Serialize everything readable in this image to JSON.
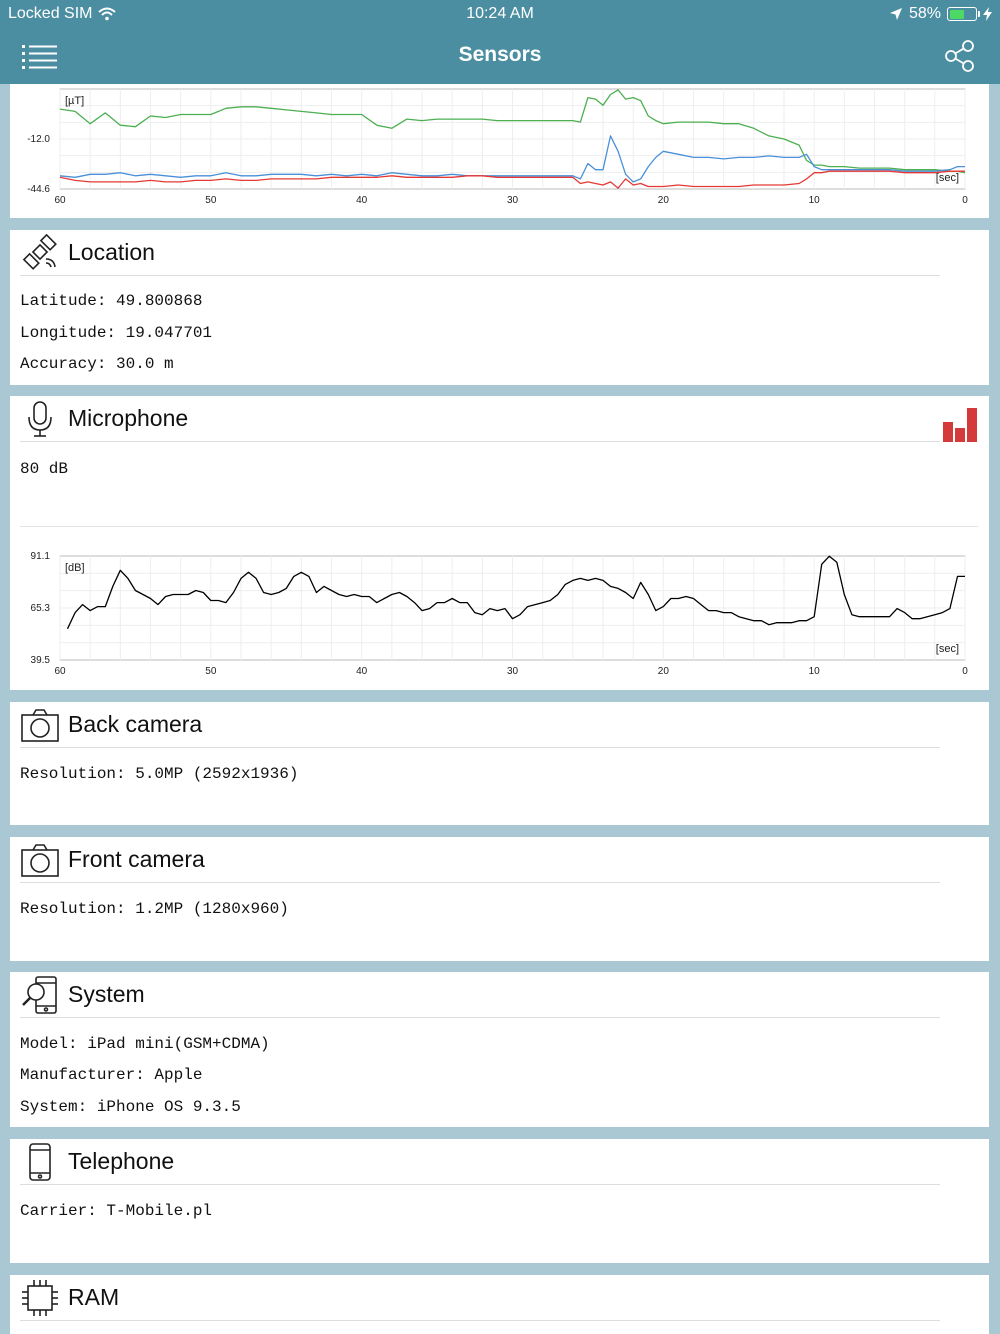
{
  "status_bar": {
    "carrier": "Locked SIM",
    "time": "10:24 AM",
    "battery_percent": "58%",
    "battery_level": 0.58
  },
  "nav": {
    "title": "Sensors",
    "menu_icon": "hamburger-icon",
    "share_icon": "share-icon"
  },
  "magnetometer": {
    "chart_data": {
      "type": "line",
      "ylabel": "[µT]",
      "xlabel": "[sec]",
      "y_ticks": [
        "-12.0",
        "-44.6"
      ],
      "x_ticks": [
        "60",
        "50",
        "40",
        "30",
        "20",
        "10",
        "0"
      ],
      "xlim": [
        60,
        0
      ],
      "ylim": [
        -44.6,
        20.6
      ],
      "series": [
        {
          "color": "#4caf50",
          "x": [
            60,
            59,
            58,
            57,
            56,
            55,
            54,
            53,
            52,
            51,
            50,
            49,
            48,
            47,
            46,
            45,
            44,
            43,
            42,
            41,
            40,
            39,
            38,
            37,
            36,
            35,
            34,
            33,
            32,
            31,
            30,
            29,
            28,
            27,
            26,
            25.5,
            25,
            24.5,
            24,
            23.5,
            23,
            22.5,
            22,
            21.5,
            21,
            20.5,
            20,
            19,
            18,
            17,
            16,
            15,
            14,
            13,
            12,
            11,
            10.5,
            10,
            9.5,
            9,
            8,
            7,
            6,
            5,
            4,
            3,
            2,
            1,
            0.5,
            0
          ],
          "values": [
            7.5,
            6,
            -2,
            5,
            -3,
            -4,
            3,
            2,
            4,
            4,
            4,
            8,
            9,
            9,
            8,
            7,
            6,
            5,
            4,
            4,
            4,
            -3,
            -5,
            1,
            0,
            1,
            1,
            1,
            1,
            0,
            0,
            0,
            0,
            0,
            0,
            -1,
            15,
            14,
            10,
            17,
            20,
            14,
            15,
            13,
            3,
            0,
            -2,
            -1,
            -1,
            -1,
            -2,
            -2,
            -5,
            -10,
            -12,
            -16,
            -26,
            -29,
            -29,
            -30,
            -30,
            -31,
            -31,
            -31,
            -32,
            -32,
            -32,
            -33,
            -33,
            -34
          ]
        },
        {
          "color": "#4a90d9",
          "x": [
            60,
            59,
            58,
            57,
            56,
            55,
            54,
            53,
            52,
            51,
            50,
            49,
            48,
            47,
            46,
            45,
            44,
            43,
            42,
            41,
            40,
            39,
            38,
            37,
            36,
            35,
            34,
            33,
            32,
            31,
            30,
            29,
            28,
            27,
            26,
            25.5,
            25,
            24.5,
            24,
            23.5,
            23,
            22.5,
            22,
            21.5,
            21,
            20.5,
            20,
            19,
            18,
            17,
            16,
            15,
            14,
            13,
            12,
            11,
            10.5,
            10,
            9.5,
            9,
            8,
            7,
            6,
            5,
            4,
            3,
            2,
            1,
            0.5,
            0
          ],
          "values": [
            -36,
            -37,
            -35,
            -35,
            -34,
            -36,
            -35,
            -36,
            -37,
            -36,
            -36,
            -34,
            -36,
            -36,
            -35,
            -35,
            -35,
            -36,
            -35,
            -36,
            -35,
            -36,
            -34,
            -35,
            -36,
            -36,
            -35,
            -36,
            -36,
            -36,
            -36,
            -36,
            -36,
            -36,
            -36,
            -38,
            -28,
            -32,
            -32,
            -10,
            -20,
            -35,
            -40,
            -38,
            -30,
            -24,
            -20,
            -22,
            -24,
            -24,
            -25,
            -24,
            -24,
            -23,
            -24,
            -24,
            -22,
            -30,
            -32,
            -32,
            -32,
            -32,
            -32,
            -32,
            -33,
            -33,
            -33,
            -32,
            -30,
            -30
          ]
        },
        {
          "color": "#e53935",
          "x": [
            60,
            59,
            58,
            57,
            56,
            55,
            54,
            53,
            52,
            51,
            50,
            49,
            48,
            47,
            46,
            45,
            44,
            43,
            42,
            41,
            40,
            39,
            38,
            37,
            36,
            35,
            34,
            33,
            32,
            31,
            30,
            29,
            28,
            27,
            26,
            25.5,
            25,
            24.5,
            24,
            23.5,
            23,
            22.5,
            22,
            21.5,
            21,
            20.5,
            20,
            19,
            18,
            17,
            16,
            15,
            14,
            13,
            12,
            11,
            10.5,
            10,
            9.5,
            9,
            8,
            7,
            6,
            5,
            4,
            3,
            2,
            1,
            0.5,
            0
          ],
          "values": [
            -37,
            -39,
            -40,
            -40,
            -40,
            -40,
            -39,
            -40,
            -40,
            -39,
            -39,
            -38,
            -39,
            -39,
            -38,
            -38,
            -38,
            -38,
            -37,
            -37,
            -37,
            -37,
            -36,
            -37,
            -37,
            -37,
            -37,
            -36,
            -36,
            -37,
            -37,
            -37,
            -37,
            -37,
            -37,
            -41,
            -40,
            -41,
            -42,
            -40,
            -44,
            -38,
            -42,
            -41,
            -43,
            -43,
            -43,
            -42,
            -43,
            -43,
            -43,
            -43,
            -42,
            -42,
            -42,
            -41,
            -38,
            -34,
            -34,
            -33,
            -33,
            -33,
            -33,
            -33,
            -34,
            -34,
            -34,
            -33,
            -33,
            -33
          ]
        }
      ]
    }
  },
  "location": {
    "title": "Location",
    "icon": "satellite-icon",
    "latitude": "Latitude: 49.800868",
    "longitude": "Longitude: 19.047701",
    "accuracy": "Accuracy: 30.0 m"
  },
  "microphone": {
    "title": "Microphone",
    "icon": "microphone-icon",
    "level_icon": "level-bars-icon",
    "level_color": "#d43a3a",
    "value": "80 dB",
    "chart_data": {
      "type": "line",
      "ylabel": "[dB]",
      "xlabel": "[sec]",
      "y_ticks": [
        "91.1",
        "65.3",
        "39.5"
      ],
      "x_ticks": [
        "60",
        "50",
        "40",
        "30",
        "20",
        "10",
        "0"
      ],
      "xlim": [
        60,
        0
      ],
      "ylim": [
        39.5,
        91.1
      ],
      "series": [
        {
          "color": "#000000",
          "x": [
            59.5,
            59,
            58.5,
            58,
            57.5,
            57,
            56.5,
            56,
            55.5,
            55,
            54.5,
            54,
            53.5,
            53,
            52.5,
            52,
            51.5,
            51,
            50.5,
            50,
            49.5,
            49,
            48.5,
            48,
            47.5,
            47,
            46.5,
            46,
            45.5,
            45,
            44.5,
            44,
            43.5,
            43,
            42.5,
            42,
            41.5,
            41,
            40.5,
            40,
            39.5,
            39,
            38.5,
            38,
            37.5,
            37,
            36.5,
            36,
            35.5,
            35,
            34.5,
            34,
            33.5,
            33,
            32.5,
            32,
            31.5,
            31,
            30.5,
            30,
            29.5,
            29,
            28.5,
            28,
            27.5,
            27,
            26.5,
            26,
            25.5,
            25,
            24.5,
            24,
            23.5,
            23,
            22.5,
            22,
            21.5,
            21,
            20.5,
            20,
            19.5,
            19,
            18.5,
            18,
            17.5,
            17,
            16.5,
            16,
            15.5,
            15,
            14.5,
            14,
            13.5,
            13,
            12.5,
            12,
            11.5,
            11,
            10.5,
            10,
            9.5,
            9,
            8.5,
            8,
            7.5,
            7,
            6.5,
            6,
            5.5,
            5,
            4.5,
            4,
            3.5,
            3,
            2.5,
            2,
            1.5,
            1,
            0.5,
            0
          ],
          "values": [
            55,
            63,
            67,
            64,
            66,
            66,
            76,
            84,
            80,
            74,
            72,
            70,
            67,
            71,
            72,
            72,
            72,
            74,
            73,
            69,
            69,
            68,
            73,
            80,
            83,
            80,
            73,
            72,
            73,
            75,
            81,
            83,
            81,
            73,
            76,
            74,
            72,
            71,
            72,
            71,
            71,
            68,
            70,
            72,
            73,
            71,
            68,
            64,
            65,
            68,
            68,
            70,
            68,
            68,
            63,
            62,
            65,
            64,
            65,
            60,
            62,
            66,
            67,
            68,
            69,
            72,
            77,
            79,
            80,
            79,
            80,
            79,
            76,
            75,
            73,
            70,
            78,
            72,
            64,
            66,
            70,
            70,
            71,
            70,
            67,
            64,
            64,
            63,
            63,
            61,
            60,
            59,
            59,
            57,
            58,
            58,
            58,
            59,
            59,
            61,
            87,
            91,
            88,
            72,
            62,
            61,
            61,
            61,
            61,
            61,
            65,
            63,
            60,
            60,
            61,
            62,
            63,
            65,
            81,
            81
          ]
        }
      ]
    }
  },
  "back_camera": {
    "title": "Back camera",
    "icon": "camera-icon",
    "resolution": "Resolution: 5.0MP (2592x1936)"
  },
  "front_camera": {
    "title": "Front camera",
    "icon": "camera-icon",
    "resolution": "Resolution: 1.2MP (1280x960)"
  },
  "system": {
    "title": "System",
    "icon": "device-search-icon",
    "model": "Model: iPad mini(GSM+CDMA)",
    "manufacturer": "Manufacturer: Apple",
    "os": "System: iPhone OS 9.3.5"
  },
  "telephone": {
    "title": "Telephone",
    "icon": "phone-icon",
    "carrier": "Carrier: T-Mobile.pl"
  },
  "ram": {
    "title": "RAM",
    "icon": "chip-icon"
  }
}
